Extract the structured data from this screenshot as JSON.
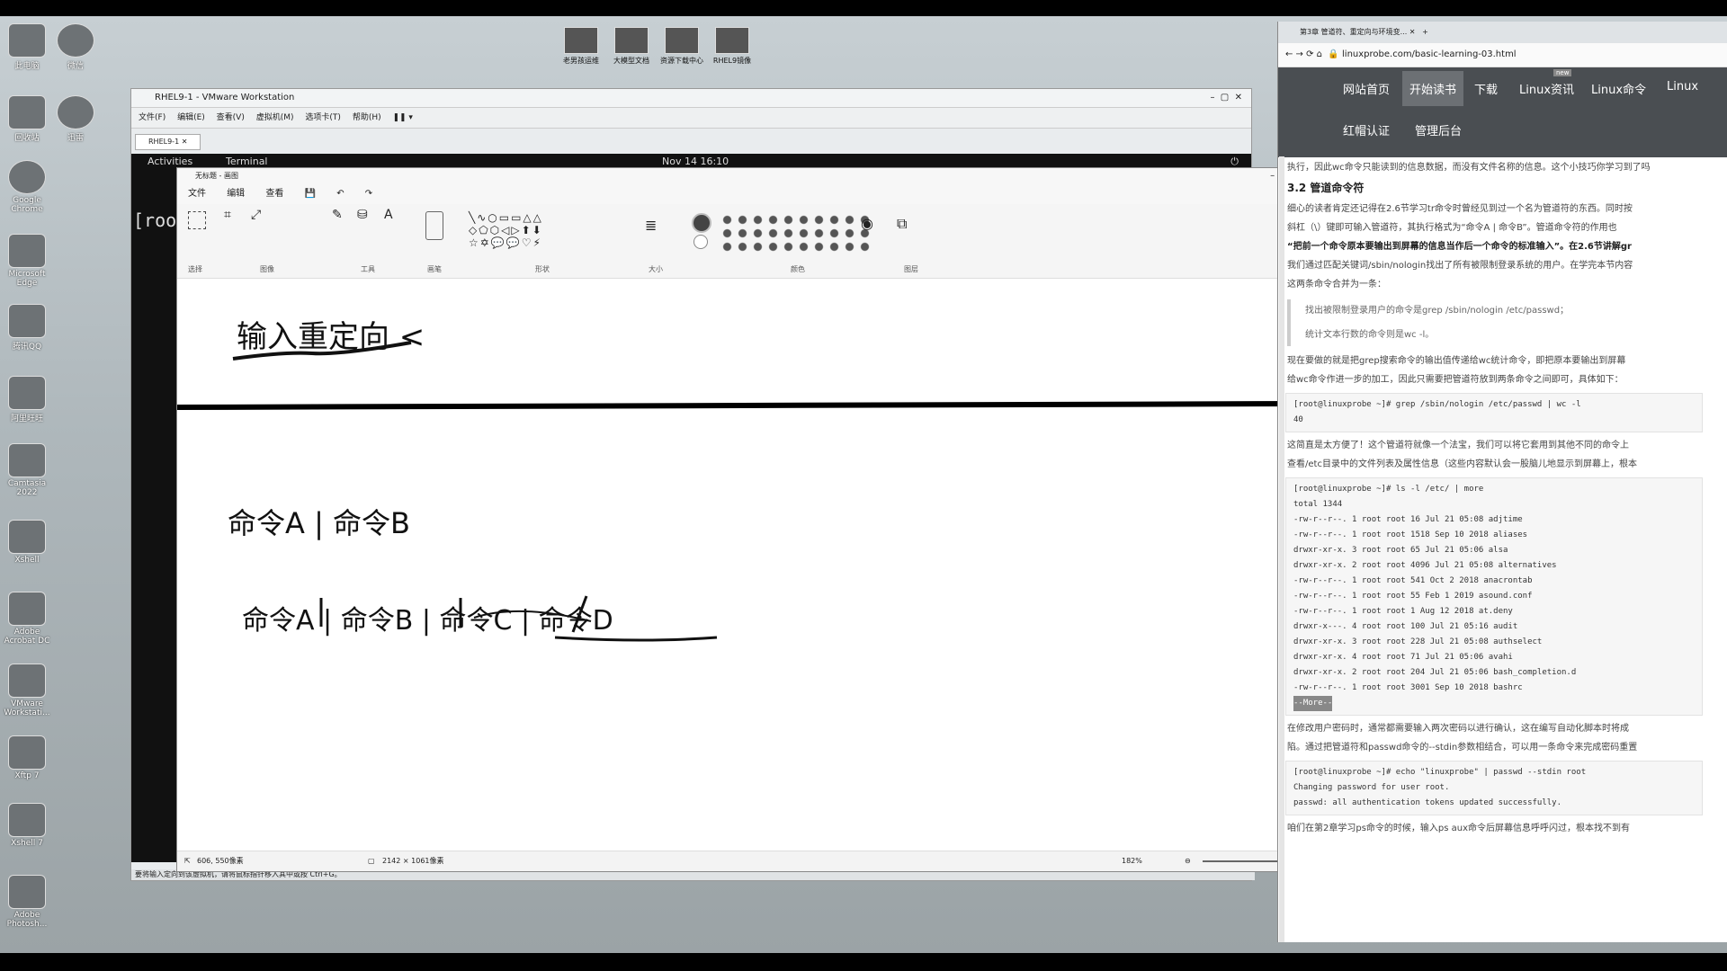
{
  "desktop": {
    "left_icons": [
      "此电脑",
      "回收站",
      "Google Chrome",
      "Microsoft Edge",
      "腾讯QQ",
      "阿里旺旺",
      "Camtasia 2022",
      "Xshell",
      "Adobe Acrobat DC",
      "VMware Workstati...",
      "Xftp 7",
      "Xshell 7",
      "Adobe Photosh..."
    ],
    "second_col_icons": [
      "微信",
      "迅雷"
    ],
    "top_icons": [
      "老男孩运维",
      "大模型文档",
      "资源下载中心",
      "RHEL9镜像"
    ]
  },
  "vmware": {
    "title": "RHEL9-1 - VMware Workstation",
    "menu": [
      "文件(F)",
      "编辑(E)",
      "查看(V)",
      "虚拟机(M)",
      "选项卡(T)",
      "帮助(H)"
    ],
    "tab": "RHEL9-1",
    "gnome_activities": "Activities",
    "gnome_terminal": "Terminal",
    "gnome_clock": "Nov 14  16:10",
    "terminal_prompt": "[roo",
    "status": "要将输入定向到该虚拟机，请将鼠标指针移入其中或按 Ctrl+G。"
  },
  "paint": {
    "title": "无标题 - 画图",
    "menu": [
      "文件",
      "编辑",
      "查看"
    ],
    "groups": [
      "选择",
      "图像",
      "工具",
      "画笔",
      "形状",
      "大小",
      "颜色",
      "图层"
    ],
    "canvas": {
      "text1": "输入重定向 <",
      "text2": "命令A | 命令B",
      "text3": "命令A | 命令B | 命令C | 命令D"
    },
    "status": {
      "cursor": "606, 550像素",
      "size": "2142 × 1061像素",
      "zoom": "182%"
    }
  },
  "browser": {
    "tab_title": "第3章 管道符、重定向与环境变...",
    "url": "linuxprobe.com/basic-learning-03.html",
    "nav_row1": [
      "网站首页",
      "开始读书",
      "下载",
      "Linux资讯",
      "Linux命令",
      "Linux"
    ],
    "nav_row2": [
      "红帽认证",
      "管理后台"
    ],
    "nav_badge": "new",
    "intro_line": "执行，因此wc命令只能读到的信息数据，而没有文件名称的信息。这个小技巧你学习到了吗",
    "section_title": "3.2 管道命令符",
    "paragraphs": [
      "细心的读者肯定还记得在2.6节学习tr命令时曾经见到过一个名为管道符的东西。同时按",
      "斜杠（\\）键即可输入管道符，其执行格式为“命令A | 命令B”。管道命令符的作用也",
      "“把前一个命令原本要输出到屏幕的信息当作后一个命令的标准输入”。在2.6节讲解gr",
      "我们通过匹配关键词/sbin/nologin找出了所有被限制登录系统的用户。在学完本节内容",
      "这两条命令合并为一条："
    ],
    "quote_lines": [
      "找出被限制登录用户的命令是grep /sbin/nologin /etc/passwd；",
      "统计文本行数的命令则是wc -l。"
    ],
    "para2": [
      "现在要做的就是把grep搜索命令的输出值传递给wc统计命令，即把原本要输出到屏幕",
      "给wc命令作进一步的加工，因此只需要把管道符放到两条命令之间即可，具体如下："
    ],
    "code1": [
      "[root@linuxprobe ~]# grep /sbin/nologin /etc/passwd | wc -l",
      "40"
    ],
    "para3": [
      "这简直是太方便了！这个管道符就像一个法宝，我们可以将它套用到其他不同的命令上",
      "查看/etc目录中的文件列表及属性信息（这些内容默认会一股脑儿地显示到屏幕上，根本"
    ],
    "code2": [
      "[root@linuxprobe ~]# ls -l /etc/ | more",
      "total 1344",
      "-rw-r--r--. 1 root root 16 Jul 21 05:08 adjtime",
      "-rw-r--r--. 1 root root 1518 Sep 10 2018 aliases",
      "drwxr-xr-x. 3 root root 65 Jul 21 05:06 alsa",
      "drwxr-xr-x. 2 root root 4096 Jul 21 05:08 alternatives",
      "-rw-r--r--. 1 root root 541 Oct 2 2018 anacrontab",
      "-rw-r--r--. 1 root root 55 Feb 1 2019 asound.conf",
      "-rw-r--r--. 1 root root 1 Aug 12 2018 at.deny",
      "drwxr-x---. 4 root root 100 Jul 21 05:16 audit",
      "drwxr-xr-x. 3 root root 228 Jul 21 05:08 authselect",
      "drwxr-xr-x. 4 root root 71 Jul 21 05:06 avahi",
      "drwxr-xr-x. 2 root root 204 Jul 21 05:06 bash_completion.d",
      "-rw-r--r--. 1 root root 3001 Sep 10 2018 bashrc",
      "--More--"
    ],
    "para4": [
      "在修改用户密码时，通常都需要输入两次密码以进行确认，这在编写自动化脚本时将成",
      "陷。通过把管道符和passwd命令的--stdin参数相结合，可以用一条命令来完成密码重置"
    ],
    "code3": [
      "[root@linuxprobe ~]# echo \"linuxprobe\" | passwd --stdin root",
      "Changing password for user root.",
      "passwd: all authentication tokens updated successfully."
    ],
    "para5": "咱们在第2章学习ps命令的时候，输入ps aux命令后屏幕信息呼呼闪过，根本找不到有"
  }
}
